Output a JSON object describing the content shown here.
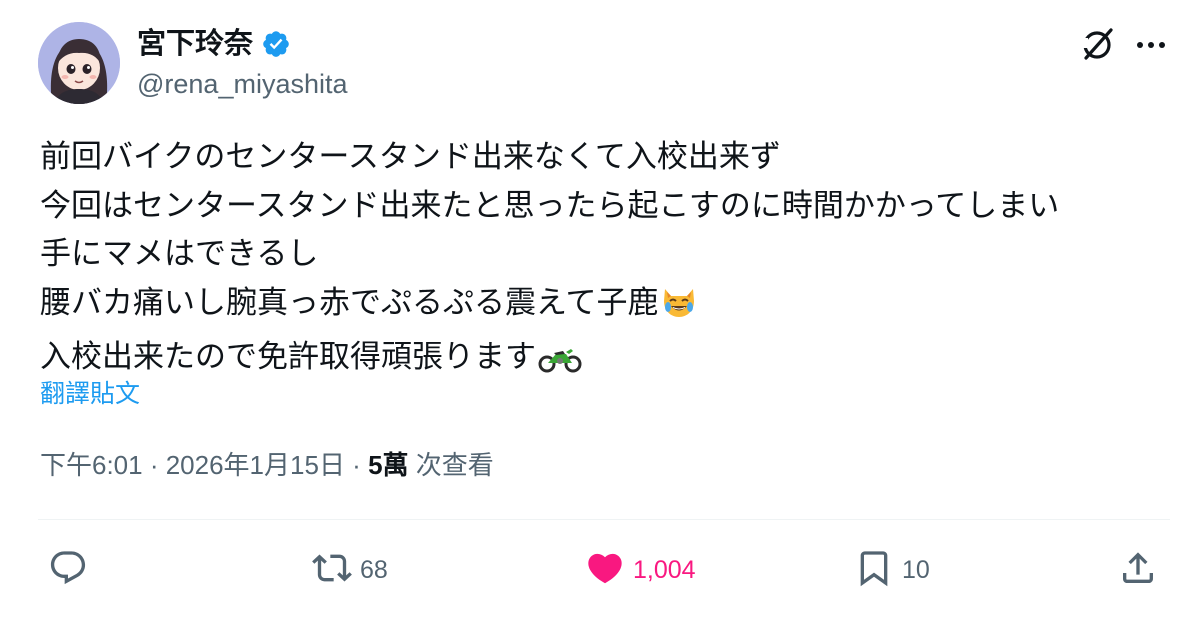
{
  "author": {
    "display_name": "宮下玲奈",
    "handle": "@rena_miyashita",
    "verified": true,
    "verified_color": "#1d9bf0"
  },
  "header_icons": {
    "grok": "grok-icon",
    "more": "more-icon"
  },
  "tweet": {
    "lines": [
      "前回バイクのセンタースタンド出来なくて入校出来ず",
      "今回はセンタースタンド出来たと思ったら起こすのに時間かかってしまい",
      "手にマメはできるし",
      "腰バカ痛いし腕真っ赤でぷるぷる震えて子鹿",
      "入校出来たので免許取得頑張ります"
    ],
    "emoji_line4": "cat-tears-of-joy-emoji",
    "emoji_line5": "motorcycle-emoji",
    "translate_label": "翻譯貼文"
  },
  "meta": {
    "time": "下午6:01",
    "separator1": " · ",
    "date": "2026年1月15日",
    "separator2": " · ",
    "views_count": "5萬",
    "views_label": " 次查看"
  },
  "actions": {
    "reply": {
      "icon": "reply-icon",
      "count": ""
    },
    "retweet": {
      "icon": "retweet-icon",
      "count": "68"
    },
    "like": {
      "icon": "heart-icon",
      "count": "1,004",
      "liked": true,
      "color": "#f91880"
    },
    "bookmark": {
      "icon": "bookmark-icon",
      "count": "10"
    },
    "share": {
      "icon": "share-icon",
      "count": ""
    }
  },
  "colors": {
    "text": "#0f1419",
    "secondary": "#536471",
    "link": "#1d9bf0",
    "like": "#f91880",
    "divider": "#eff3f4"
  }
}
